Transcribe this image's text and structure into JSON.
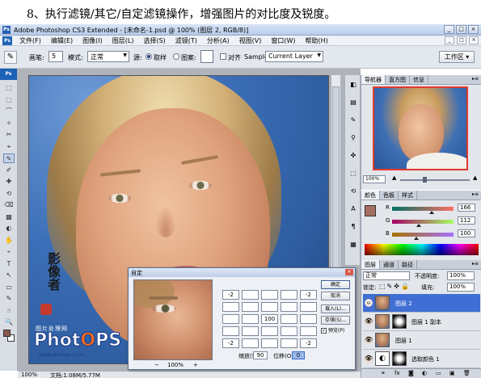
{
  "caption": "8、执行滤镜/其它/自定滤镜操作，增强图片的对比度及锐度。",
  "window": {
    "title": "Adobe Photoshop CS3 Extended - [未命名-1.psd @ 100% (图层 2, RGB/8)]",
    "controls": [
      "_",
      "□",
      "×"
    ]
  },
  "menubar": {
    "logo": "Ps",
    "items": [
      "文件(F)",
      "编辑(E)",
      "图像(I)",
      "图层(L)",
      "选择(S)",
      "滤镜(T)",
      "分析(A)",
      "视图(V)",
      "窗口(W)",
      "帮助(H)"
    ],
    "doc_controls": [
      "_",
      "□",
      "×"
    ]
  },
  "options": {
    "tool_icon": "✎",
    "brush_label": "画笔:",
    "brush_size": "5",
    "mode_label": "模式:",
    "mode_value": "正常",
    "source_label": "源:",
    "source_sampled": "取样",
    "source_pattern": "图案:",
    "aligned_label": "对齐",
    "sample_label": "Sample:",
    "sample_value": "Current Layer",
    "workspace": "工作区 ▾"
  },
  "toolbox": {
    "header": "Ps",
    "tools": [
      "⬚",
      "⬚",
      "⌒",
      "✧",
      "✂",
      "⌖",
      "✎",
      "✐",
      "✚",
      "⟲",
      "⌫",
      "▩",
      "◐",
      "✋",
      "⌁",
      "T",
      "↖",
      "▭",
      "✎",
      "☝",
      "🔍"
    ],
    "active_index": 6
  },
  "document": {
    "watermark_cn": "影像者",
    "site_text": "图片处理网",
    "brand_logo_left": "Phot",
    "brand_logo_o": "O",
    "brand_logo_right": "PS",
    "brand_url": "www.photops.com"
  },
  "statusbar": {
    "zoom": "100%",
    "doc_info": "文档:1.08M/5.77M"
  },
  "dialog": {
    "title": "自定",
    "zoom_minus": "−",
    "zoom_pct": "100%",
    "zoom_plus": "+",
    "matrix": [
      [
        "-2",
        "",
        "",
        "",
        "-2"
      ],
      [
        "",
        "",
        "",
        "",
        ""
      ],
      [
        "",
        "",
        "100",
        "",
        ""
      ],
      [
        "",
        "",
        "",
        "",
        ""
      ],
      [
        "-2",
        "",
        "",
        "",
        "-2"
      ]
    ],
    "scale_label": "缩放(S):",
    "scale_value": "90",
    "offset_label": "位移(O):",
    "offset_value": "0",
    "buttons": {
      "ok": "确定",
      "cancel": "取消",
      "load": "载入(L)...",
      "save": "存储(S)..."
    },
    "preview_label": "预览(P)",
    "preview_checked": "✓"
  },
  "icon_strip": [
    "◧",
    "▤",
    "✎",
    "⚲",
    "✜",
    "⬚",
    "⟲",
    "A",
    "¶",
    "▦"
  ],
  "navigator": {
    "tabs": [
      "导航器",
      "直方图",
      "信息"
    ],
    "active_tab": 0,
    "zoom_value": "100%",
    "zoom_level": 0.35
  },
  "color_panel": {
    "tabs": [
      "颜色",
      "色板",
      "样式"
    ],
    "active_tab": 0,
    "fg_color": "#a66f63",
    "channels": [
      {
        "label": "R",
        "value": "166",
        "level": 0.65
      },
      {
        "label": "G",
        "value": "112",
        "level": 0.44
      },
      {
        "label": "B",
        "value": "100",
        "level": 0.39
      }
    ]
  },
  "layers_panel": {
    "tabs": [
      "图层",
      "通道",
      "路径"
    ],
    "active_tab": 0,
    "blend_mode": "正常",
    "opacity_label": "不透明度:",
    "opacity_value": "100%",
    "lock_label": "锁定:",
    "lock_icons": "⬚✎✜🔒",
    "fill_label": "填充:",
    "fill_value": "100%",
    "layers": [
      {
        "name": "图层 2",
        "selected": true,
        "has_mask": false,
        "type": "pixel"
      },
      {
        "name": "图层 1 副本",
        "selected": false,
        "has_mask": true,
        "type": "pixel"
      },
      {
        "name": "图层 1",
        "selected": false,
        "has_mask": false,
        "type": "pixel"
      },
      {
        "name": "选取颜色 1",
        "selected": false,
        "has_mask": true,
        "type": "adjustment"
      }
    ],
    "bottom_icons": [
      "⚭",
      "fx",
      "◙",
      "◐",
      "▭",
      "▣",
      "🗑"
    ]
  },
  "colors": {
    "selection_blue": "#3f6fd4",
    "title_gradient": "#c9d8ef",
    "ps_blue": "#1c62b6"
  }
}
